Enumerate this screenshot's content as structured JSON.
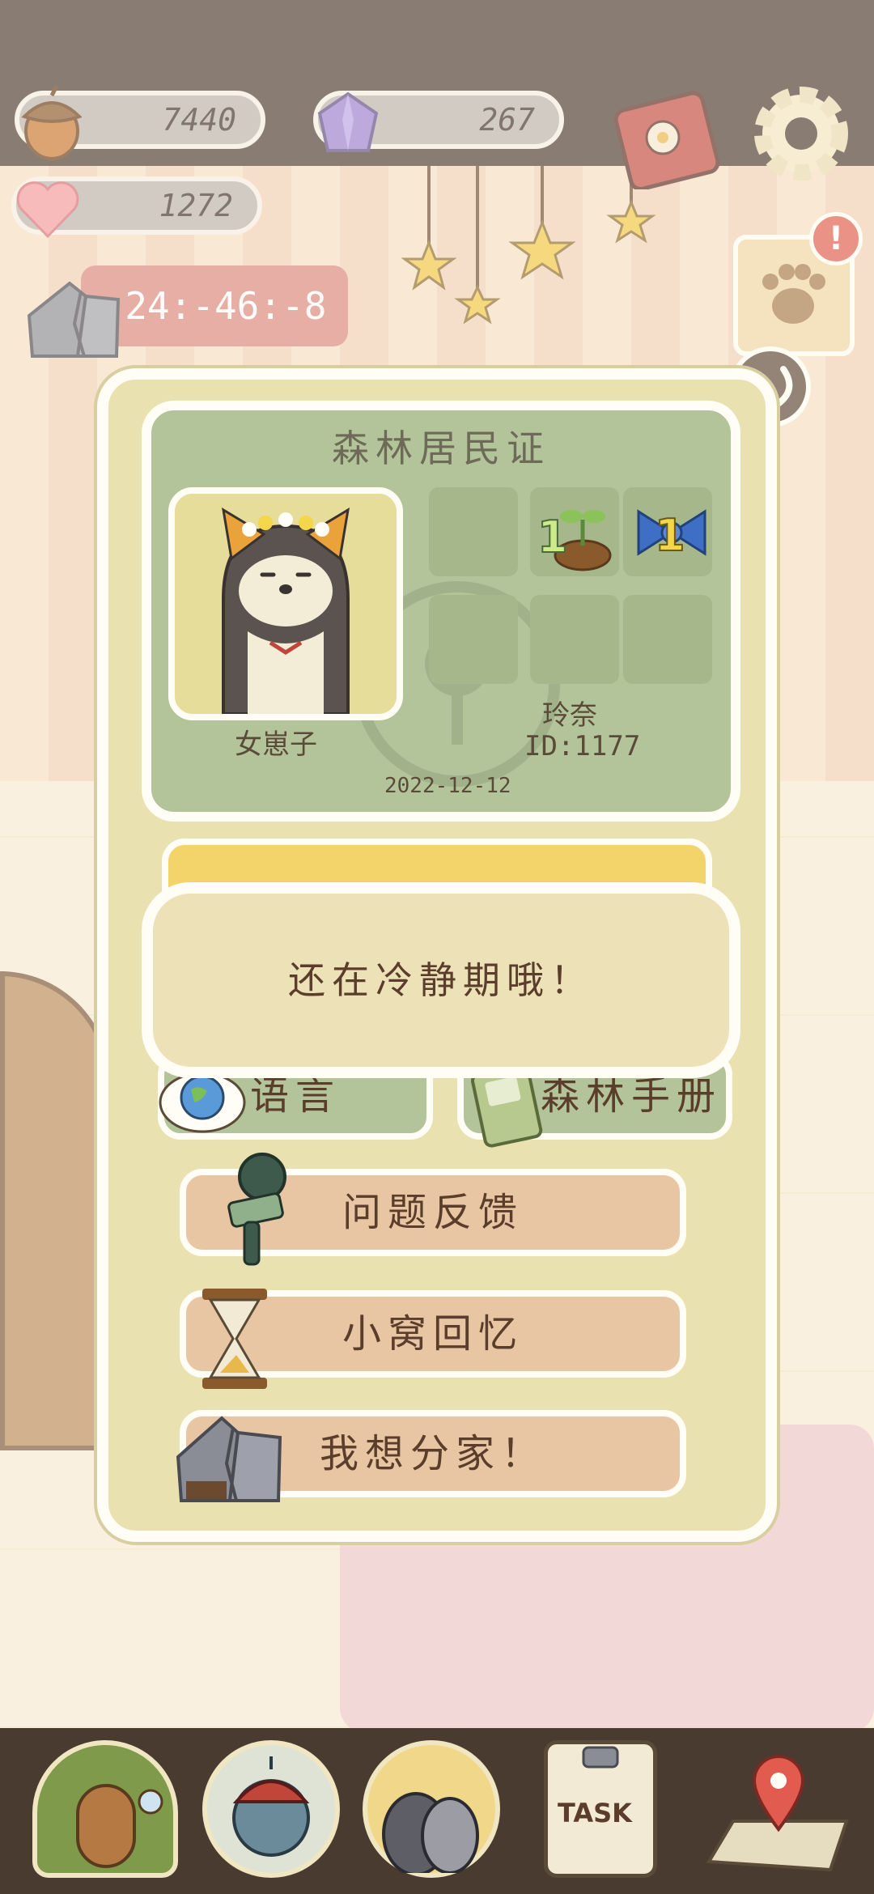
{
  "hud": {
    "acorns": "7440",
    "gems": "267",
    "hearts": "1272",
    "timer": "-24:-46:-8"
  },
  "resident_card": {
    "title": "森林居民证",
    "player_title": "女崽子",
    "player_name": "玲奈",
    "player_id": "ID:1177",
    "date": "2022-12-12",
    "badges": [
      {
        "icon": "sprout-icon",
        "count": "1"
      },
      {
        "icon": "bow-icon",
        "count": "1"
      }
    ]
  },
  "menu": {
    "language_label": "语言",
    "handbook_label": "森林手册",
    "feedback_label": "问题反馈",
    "memories_label": "小窝回忆",
    "split_home_label": "我想分家！"
  },
  "toast": {
    "message": "还在冷静期哦！"
  },
  "notification": {
    "badge": "!"
  },
  "task": {
    "label": "TASK"
  },
  "colors": {
    "dialog_bg": "#e9e2b0",
    "card_green": "#b4c49a",
    "button_peach": "#e9c6a3",
    "timer_red": "#d9867d"
  }
}
